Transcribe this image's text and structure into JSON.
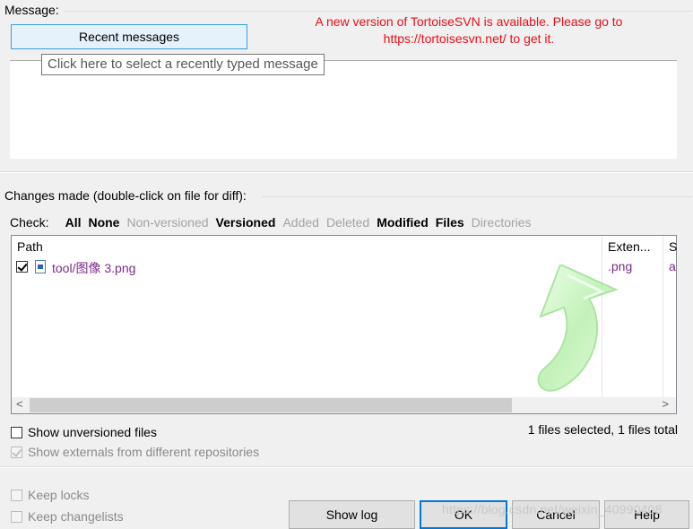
{
  "message": {
    "label": "Message:",
    "recent_button": "Recent messages",
    "new_version_notice": "A new version of TortoiseSVN is available. Please go to https://tortoisesvn.net/ to get it.",
    "tooltip": "Click here to select a recently typed message"
  },
  "changes": {
    "label": "Changes made (double-click on file for diff):",
    "check_label": "Check:",
    "filters": [
      {
        "label": "All",
        "enabled": true
      },
      {
        "label": "None",
        "enabled": true
      },
      {
        "label": "Non-versioned",
        "enabled": false
      },
      {
        "label": "Versioned",
        "enabled": true
      },
      {
        "label": "Added",
        "enabled": false
      },
      {
        "label": "Deleted",
        "enabled": false
      },
      {
        "label": "Modified",
        "enabled": true
      },
      {
        "label": "Files",
        "enabled": true
      },
      {
        "label": "Directories",
        "enabled": false
      }
    ],
    "columns": {
      "path": "Path",
      "extension": "Exten...",
      "status": "S"
    },
    "rows": [
      {
        "checked": true,
        "path": "tool/图像 3.png",
        "extension": ".png",
        "status": "a"
      }
    ],
    "scroll_left": "<",
    "scroll_right": ">"
  },
  "options": {
    "show_unversioned": "Show unversioned files",
    "show_externals": "Show externals from different repositories",
    "keep_locks": "Keep locks",
    "keep_changelists": "Keep changelists"
  },
  "status": {
    "selection": "1 files selected, 1 files total"
  },
  "buttons": {
    "show_log": "Show log",
    "ok": "OK",
    "cancel": "Cancel",
    "help": "Help"
  },
  "watermark": "https://blog.csdn.net/weixin_40990408",
  "colors": {
    "notice": "#e3101b",
    "file_text": "#7b2a8c",
    "recent_button_bg": "#e5f1fb",
    "ok_border": "#0078d7"
  }
}
